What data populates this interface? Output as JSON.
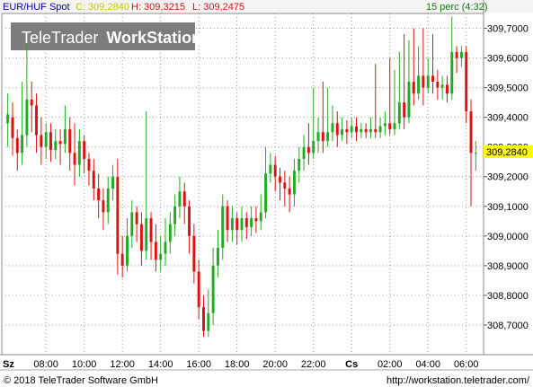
{
  "header": {
    "symbol": "EUR/HUF Spot",
    "close": "C: 309,2840",
    "high": "H: 309,3215",
    "low": "L: 309,2475",
    "interval": "15 perc (4:32)"
  },
  "watermark": {
    "brand": "TeleTrader",
    "product": "WorkStation"
  },
  "footer": {
    "copyright": "© 2018 TeleTrader Software GmbH",
    "url": "http://workstation.teletrader.com/"
  },
  "price_label": "309,2840",
  "colors": {
    "up": "#22aa22",
    "down": "#dd1111",
    "label_bg": "#ffff00",
    "close_color": "#c8c800"
  },
  "chart_data": {
    "type": "candlestick",
    "ylim": [
      308.6,
      309.75
    ],
    "y_ticks": [
      "308,7000",
      "308,8000",
      "308,9000",
      "309,0000",
      "309,1000",
      "309,2000",
      "309,3000",
      "309,4000",
      "309,5000",
      "309,6000",
      "309,7000"
    ],
    "y_tick_values": [
      308.7,
      308.8,
      308.9,
      309.0,
      309.1,
      309.2,
      309.3,
      309.4,
      309.5,
      309.6,
      309.7
    ],
    "x_ticks": [
      "Sz",
      "08:00",
      "10:00",
      "12:00",
      "14:00",
      "16:00",
      "18:00",
      "20:00",
      "22:00",
      "Cs",
      "02:00",
      "04:00",
      "06:00"
    ],
    "x_tick_index": [
      0,
      8,
      16,
      24,
      32,
      40,
      48,
      56,
      64,
      72,
      80,
      88,
      96
    ],
    "last": 309.284,
    "candles": [
      [
        309.38,
        309.41,
        309.3,
        309.48
      ],
      [
        309.4,
        309.33,
        309.27,
        309.45
      ],
      [
        309.33,
        309.28,
        309.22,
        309.36
      ],
      [
        309.28,
        309.34,
        309.24,
        309.52
      ],
      [
        309.34,
        309.46,
        309.3,
        309.65
      ],
      [
        309.46,
        309.44,
        309.35,
        309.52
      ],
      [
        309.44,
        309.34,
        309.28,
        309.48
      ],
      [
        309.34,
        309.3,
        309.24,
        309.4
      ],
      [
        309.3,
        309.35,
        309.26,
        309.38
      ],
      [
        309.35,
        309.29,
        309.25,
        309.38
      ],
      [
        309.29,
        309.32,
        309.26,
        309.36
      ],
      [
        309.32,
        309.31,
        309.24,
        309.36
      ],
      [
        309.31,
        309.36,
        309.28,
        309.44
      ],
      [
        309.36,
        309.28,
        309.22,
        309.4
      ],
      [
        309.28,
        309.24,
        309.17,
        309.38
      ],
      [
        309.24,
        309.32,
        309.2,
        309.36
      ],
      [
        309.32,
        309.26,
        309.21,
        309.34
      ],
      [
        309.26,
        309.22,
        309.17,
        309.28
      ],
      [
        309.22,
        309.16,
        309.12,
        309.26
      ],
      [
        309.16,
        309.12,
        309.06,
        309.21
      ],
      [
        309.12,
        309.08,
        309.02,
        309.16
      ],
      [
        309.08,
        309.16,
        309.04,
        309.2
      ],
      [
        309.16,
        309.2,
        309.12,
        309.24
      ],
      [
        309.2,
        308.94,
        308.87,
        309.26
      ],
      [
        308.94,
        308.9,
        308.86,
        309.0
      ],
      [
        308.9,
        309.0,
        308.88,
        309.06
      ],
      [
        309.0,
        309.08,
        308.96,
        309.12
      ],
      [
        309.08,
        309.04,
        308.98,
        309.1
      ],
      [
        309.04,
        308.95,
        308.9,
        309.08
      ],
      [
        308.95,
        309.06,
        308.92,
        309.42
      ],
      [
        309.06,
        308.98,
        308.92,
        309.08
      ],
      [
        308.98,
        308.92,
        308.88,
        309.04
      ],
      [
        308.92,
        308.94,
        308.88,
        309.0
      ],
      [
        308.94,
        308.98,
        308.9,
        309.06
      ],
      [
        308.98,
        309.04,
        308.94,
        309.08
      ],
      [
        309.04,
        309.1,
        309.0,
        309.14
      ],
      [
        309.1,
        309.15,
        309.06,
        309.2
      ],
      [
        309.15,
        309.1,
        309.04,
        309.18
      ],
      [
        309.1,
        309.0,
        308.94,
        309.12
      ],
      [
        309.0,
        308.88,
        308.84,
        309.04
      ],
      [
        308.88,
        308.76,
        308.72,
        308.92
      ],
      [
        308.76,
        308.68,
        308.66,
        308.8
      ],
      [
        308.68,
        308.74,
        308.66,
        308.82
      ],
      [
        308.74,
        308.9,
        308.7,
        308.96
      ],
      [
        308.9,
        308.96,
        308.86,
        309.02
      ],
      [
        308.96,
        309.1,
        308.92,
        309.14
      ],
      [
        309.1,
        309.02,
        308.98,
        309.12
      ],
      [
        309.02,
        309.06,
        308.98,
        309.1
      ],
      [
        309.06,
        309.02,
        308.97,
        309.08
      ],
      [
        309.02,
        309.06,
        308.98,
        309.1
      ],
      [
        309.06,
        309.03,
        308.99,
        309.08
      ],
      [
        309.03,
        309.06,
        309.0,
        309.1
      ],
      [
        309.06,
        309.05,
        309.01,
        309.1
      ],
      [
        309.05,
        309.08,
        309.02,
        309.14
      ],
      [
        309.08,
        309.21,
        309.06,
        309.3
      ],
      [
        309.21,
        309.24,
        309.18,
        309.28
      ],
      [
        309.24,
        309.2,
        309.15,
        309.27
      ],
      [
        309.2,
        309.18,
        309.12,
        309.23
      ],
      [
        309.18,
        309.16,
        309.1,
        309.22
      ],
      [
        309.16,
        309.14,
        309.08,
        309.2
      ],
      [
        309.14,
        309.22,
        309.1,
        309.26
      ],
      [
        309.22,
        309.26,
        309.18,
        309.3
      ],
      [
        309.26,
        309.3,
        309.22,
        309.34
      ],
      [
        309.3,
        309.28,
        309.24,
        309.38
      ],
      [
        309.28,
        309.32,
        309.26,
        309.5
      ],
      [
        309.32,
        309.35,
        309.28,
        309.4
      ],
      [
        309.35,
        309.32,
        309.28,
        309.52
      ],
      [
        309.32,
        309.35,
        309.3,
        309.5
      ],
      [
        309.35,
        309.38,
        309.32,
        309.44
      ],
      [
        309.38,
        309.34,
        309.3,
        309.42
      ],
      [
        309.34,
        309.36,
        309.32,
        309.4
      ],
      [
        309.36,
        309.35,
        309.31,
        309.39
      ],
      [
        309.35,
        309.37,
        309.33,
        309.4
      ],
      [
        309.37,
        309.35,
        309.32,
        309.4
      ],
      [
        309.35,
        309.36,
        309.33,
        309.38
      ],
      [
        309.36,
        309.35,
        309.33,
        309.38
      ],
      [
        309.35,
        309.36,
        309.33,
        309.4
      ],
      [
        309.36,
        309.35,
        309.33,
        309.58
      ],
      [
        309.35,
        309.37,
        309.33,
        309.4
      ],
      [
        309.37,
        309.38,
        309.34,
        309.42
      ],
      [
        309.38,
        309.36,
        309.34,
        309.6
      ],
      [
        309.36,
        309.38,
        309.34,
        309.56
      ],
      [
        309.38,
        309.45,
        309.36,
        309.62
      ],
      [
        309.45,
        309.4,
        309.36,
        309.68
      ],
      [
        309.4,
        309.52,
        309.38,
        309.66
      ],
      [
        309.52,
        309.48,
        309.44,
        309.7
      ],
      [
        309.48,
        309.54,
        309.46,
        309.64
      ],
      [
        309.54,
        309.5,
        309.44,
        309.7
      ],
      [
        309.5,
        309.54,
        309.48,
        309.6
      ],
      [
        309.54,
        309.52,
        309.48,
        309.68
      ],
      [
        309.52,
        309.5,
        309.46,
        309.56
      ],
      [
        309.5,
        309.51,
        309.46,
        309.54
      ],
      [
        309.51,
        309.48,
        309.45,
        309.54
      ],
      [
        309.48,
        309.62,
        309.46,
        309.74
      ],
      [
        309.62,
        309.6,
        309.55,
        309.64
      ],
      [
        309.6,
        309.62,
        309.57,
        309.64
      ],
      [
        309.62,
        309.42,
        309.38,
        309.64
      ],
      [
        309.42,
        309.28,
        309.1,
        309.46
      ],
      [
        309.28,
        309.28,
        309.22,
        309.32
      ]
    ]
  }
}
